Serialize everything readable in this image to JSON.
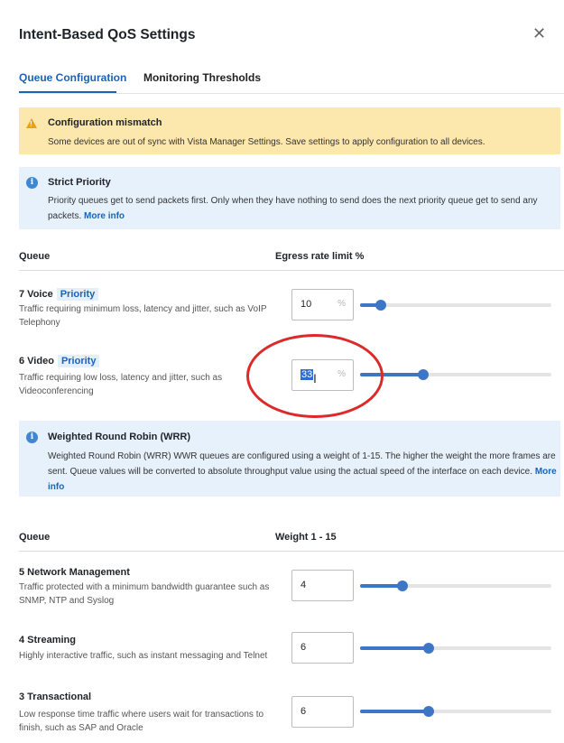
{
  "dialog": {
    "title": "Intent-Based QoS Settings",
    "close_icon": "close-icon"
  },
  "tabs": [
    {
      "label": "Queue Configuration",
      "active": true
    },
    {
      "label": "Monitoring Thresholds",
      "active": false
    }
  ],
  "warning": {
    "title": "Configuration mismatch",
    "text": "Some devices are out of sync with Vista Manager Settings. Save settings to apply configuration to all devices.",
    "icon": "warning-icon",
    "color": "#fce7ac"
  },
  "strict_info": {
    "title": "Strict Priority",
    "text": "Priority queues get to send packets first. Only when they have nothing to send does the next priority queue get to send any packets.",
    "link": "More info",
    "icon": "info-icon"
  },
  "strict_table": {
    "col_queue": "Queue",
    "col_value": "Egress rate limit %",
    "unit": "%",
    "rows": [
      {
        "name": "7 Voice",
        "badge": "Priority",
        "desc": "Traffic requiring minimum loss, latency and jitter, such as VoIP Telephony",
        "value": "10",
        "slider_fraction": 0.11
      },
      {
        "name": "6 Video",
        "badge": "Priority",
        "desc": "Traffic requiring low loss, latency and jitter, such as Videoconferencing",
        "value": "33",
        "slider_fraction": 0.33
      }
    ]
  },
  "wrr_info": {
    "title": "Weighted Round Robin (WRR)",
    "text": "Weighted Round Robin (WRR) WWR queues are configured using a weight of 1-15. The higher the weight the more frames are sent. Queue values will be converted to absolute throughput value using the actual speed of the interface on each device.",
    "link": "More info",
    "icon": "info-icon"
  },
  "wrr_table": {
    "col_queue": "Queue",
    "col_value": "Weight 1 - 15",
    "rows": [
      {
        "name": "5 Network Management",
        "desc": "Traffic protected with a minimum bandwidth guarantee such as SNMP, NTP and Syslog",
        "value": "4",
        "slider_fraction": 0.22
      },
      {
        "name": "4 Streaming",
        "desc": "Highly interactive traffic, such as instant messaging and Telnet",
        "value": "6",
        "slider_fraction": 0.36
      },
      {
        "name": "3 Transactional",
        "desc": "Low response time traffic where users wait for transactions to finish, such as SAP and Oracle",
        "value": "6",
        "slider_fraction": 0.36
      }
    ]
  },
  "colors": {
    "accent": "#1a63b8",
    "slider": "#3e76c6",
    "annotation": "#dc2a2a"
  }
}
